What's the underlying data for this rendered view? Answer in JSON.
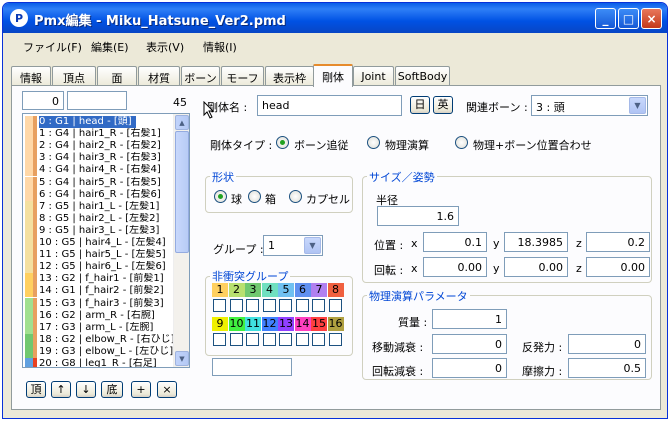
{
  "window": {
    "title": "Pmx編集 - Miku_Hatsune_Ver2.pmd",
    "app_icon": "pmx-app-icon"
  },
  "menu": [
    "ファイル(F)",
    "編集(E)",
    "表示(V)",
    "情報(I)"
  ],
  "tabs": [
    "情報",
    "頂点",
    "面",
    "材質",
    "ボーン",
    "モーフ",
    "表示枠",
    "剛体",
    "Joint",
    "SoftBody"
  ],
  "active_tab": "剛体",
  "list": {
    "top_field": "0",
    "top_field2": "",
    "count": "45",
    "items": [
      {
        "text": "0 : G1 | head - [頭]",
        "c1": "#ffd8a8",
        "c2": "#e8a060"
      },
      {
        "text": "1 : G4 | hair1_R - [右髪1]",
        "c1": "#ffd8a8",
        "c2": "#e8a060"
      },
      {
        "text": "2 : G4 | hair2_R - [右髪2]",
        "c1": "#ffd8a8",
        "c2": "#e8a060"
      },
      {
        "text": "3 : G4 | hair3_R - [右髪3]",
        "c1": "#ffd8a8",
        "c2": "#e8a060"
      },
      {
        "text": "4 : G4 | hair4_R - [右髪4]",
        "c1": "#ffd8a8",
        "c2": "#e8a060"
      },
      {
        "text": "5 : G4 | hair5_R - [右髪5]",
        "c1": "#ffd8a8",
        "c2": "#e8a060"
      },
      {
        "text": "6 : G4 | hair6_R - [右髪6]",
        "c1": "#ffd8a8",
        "c2": "#e8a060"
      },
      {
        "text": "7 : G5 | hair1_L - [左髪1]",
        "c1": "#f4e0a0",
        "c2": "#e8a060"
      },
      {
        "text": "8 : G5 | hair2_L - [左髪2]",
        "c1": "#f4e0a0",
        "c2": "#e8a060"
      },
      {
        "text": "9 : G5 | hair3_L - [左髪3]",
        "c1": "#f4e0a0",
        "c2": "#e8a060"
      },
      {
        "text": "10 : G5 | hair4_L - [左髪4]",
        "c1": "#f4e0a0",
        "c2": "#e8a060"
      },
      {
        "text": "11 : G5 | hair5_L - [左髪5]",
        "c1": "#f4e0a0",
        "c2": "#e8a060"
      },
      {
        "text": "12 : G5 | hair6_L - [左髪6]",
        "c1": "#f4e0a0",
        "c2": "#e8a060"
      },
      {
        "text": "13 : G2 | f_hair1 - [前髪1]",
        "c1": "#ffd060",
        "c2": "#e8a060"
      },
      {
        "text": "14 : G1 | f_hair2 - [前髪2]",
        "c1": "#ffd060",
        "c2": "#e8a060"
      },
      {
        "text": "15 : G3 | f_hair3 - [前髪3]",
        "c1": "#a0e090",
        "c2": "#e8a060"
      },
      {
        "text": "16 : G2 | arm_R - [右腕]",
        "c1": "#a0e090",
        "c2": "#e8a060"
      },
      {
        "text": "17 : G3 | arm_L - [左腕]",
        "c1": "#a0e090",
        "c2": "#e8a060"
      },
      {
        "text": "18 : G2 | elbow_R - [右ひじ]",
        "c1": "#70c870",
        "c2": "#e8a060"
      },
      {
        "text": "19 : G3 | elbow_L - [左ひじ]",
        "c1": "#70c870",
        "c2": "#e8a060"
      },
      {
        "text": "20 : G8 | leg1_R - [右足]",
        "c1": "#60a0e0",
        "c2": "#e84020"
      }
    ]
  },
  "list_buttons": [
    "頂",
    "↑",
    "↓",
    "底",
    "+",
    "×"
  ],
  "rigid": {
    "name_label": "剛体名 :",
    "name_value": "head",
    "btn_ja": "日",
    "btn_en": "英",
    "bone_label": "関連ボーン :",
    "bone_value": "3 : 頭",
    "type_label": "剛体タイプ :",
    "type_options": [
      "ボーン追従",
      "物理演算",
      "物理+ボーン位置合わせ"
    ],
    "type_selected": 0
  },
  "shape": {
    "title": "形状",
    "options": [
      "球",
      "箱",
      "カプセル"
    ],
    "selected": 0
  },
  "size": {
    "title": "サイズ／姿勢",
    "radius_label": "半径",
    "radius": "1.6",
    "pos_label": "位置 :",
    "rot_label": "回転 :",
    "x": "x",
    "y": "y",
    "z": "z",
    "pos": [
      "0.1",
      "18.3985",
      "0.2"
    ],
    "rot": [
      "0.00",
      "0.00",
      "0.00"
    ]
  },
  "group": {
    "label": "グループ :",
    "value": "1"
  },
  "noncollision": {
    "title": "非衝突グループ",
    "row1": [
      {
        "n": "1",
        "c": "#ffd060"
      },
      {
        "n": "2",
        "c": "#b8e070"
      },
      {
        "n": "3",
        "c": "#70c870"
      },
      {
        "n": "4",
        "c": "#70e0c0"
      },
      {
        "n": "5",
        "c": "#70c0f0"
      },
      {
        "n": "6",
        "c": "#6090f0"
      },
      {
        "n": "7",
        "c": "#b080f0"
      },
      {
        "n": "8",
        "c": "#f06040"
      }
    ],
    "row2": [
      {
        "n": "9",
        "c": "#f0f000"
      },
      {
        "n": "10",
        "c": "#40f040"
      },
      {
        "n": "11",
        "c": "#40e0e0"
      },
      {
        "n": "12",
        "c": "#4080ff"
      },
      {
        "n": "13",
        "c": "#9040ff"
      },
      {
        "n": "14",
        "c": "#ff40c0"
      },
      {
        "n": "15",
        "c": "#ff4040"
      },
      {
        "n": "16",
        "c": "#b0a040"
      }
    ]
  },
  "physics": {
    "title": "物理演算パラメータ",
    "mass_label": "質量 :",
    "mass": "1",
    "move_damp_label": "移動減衰 :",
    "move_damp": "0",
    "rot_damp_label": "回転減衰 :",
    "rot_damp": "0",
    "restitution_label": "反発力 :",
    "restitution": "0",
    "friction_label": "摩擦力 :",
    "friction": "0.5"
  }
}
